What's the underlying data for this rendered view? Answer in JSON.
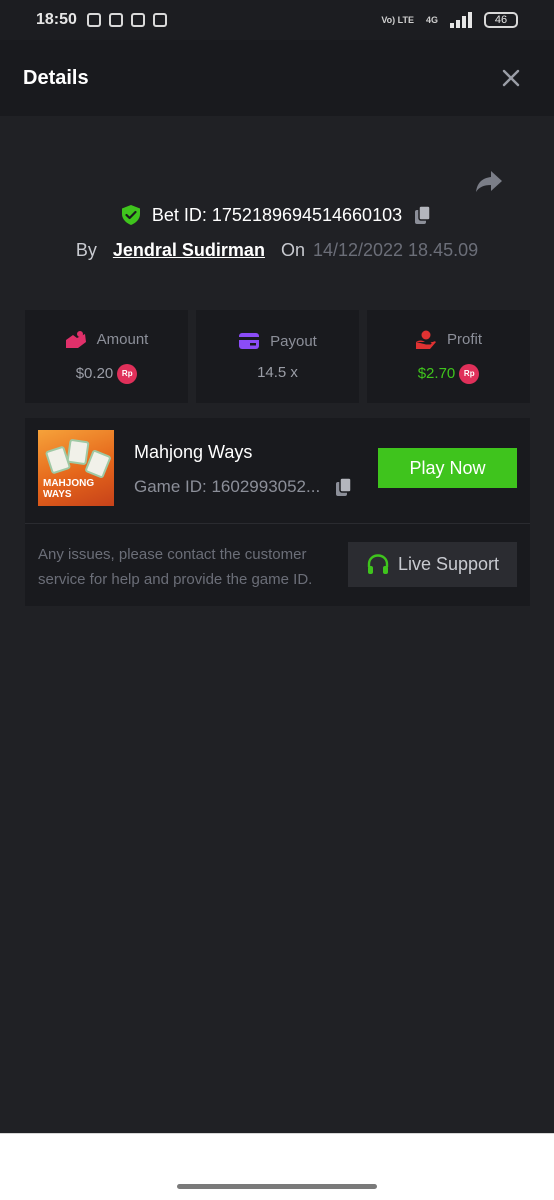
{
  "status_bar": {
    "time": "18:50",
    "battery": "46",
    "network": "Vo) LTE",
    "network_type": "4G"
  },
  "header": {
    "title": "Details"
  },
  "bet": {
    "id_label": "Bet ID: 1752189694514660103",
    "by_label": "By",
    "user": "Jendral Sudirman",
    "on_label": "On",
    "date": "14/12/2022 18.45.09"
  },
  "stats": {
    "amount": {
      "label": "Amount",
      "value": "$0.20",
      "currency": "Rp"
    },
    "payout": {
      "label": "Payout",
      "value": "14.5 x"
    },
    "profit": {
      "label": "Profit",
      "value": "$2.70",
      "currency": "Rp"
    }
  },
  "game": {
    "thumb_text": "MAHJONG WAYS",
    "name": "Mahjong Ways",
    "id_label": "Game ID: 1602993052...",
    "play_label": "Play Now"
  },
  "help": {
    "text": "Any issues, please contact the customer service for help and provide the game ID.",
    "support_label": "Live Support"
  },
  "colors": {
    "accent_green": "#3fc41d",
    "amount_icon": "#e0306a",
    "payout_icon": "#8b4cf7",
    "profit_icon": "#e03232"
  }
}
